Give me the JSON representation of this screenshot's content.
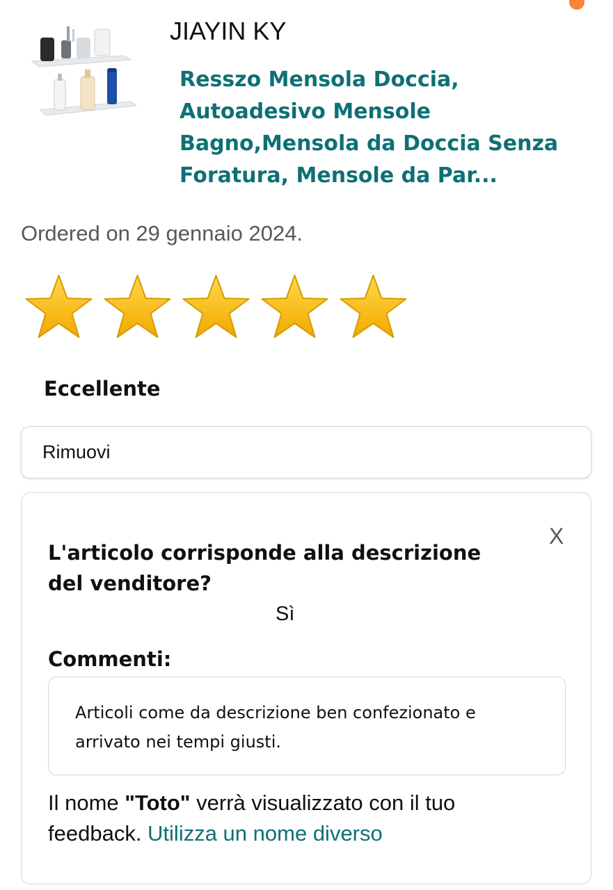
{
  "order": {
    "seller": "JIAYIN KY",
    "product_title": "Resszo Mensola Doccia, Autoadesivo Mensole Bagno,Mensola da Doccia Senza Foratura, Mensole da Par...",
    "ordered_text": "Ordered on 29 gennaio 2024."
  },
  "rating": {
    "stars": 5,
    "max_stars": 5,
    "label": "Eccellente",
    "star_color": "#f5b800"
  },
  "remove_button": {
    "label": "Rimuovi"
  },
  "feedback": {
    "close_label": "X",
    "question": "L'articolo corrisponde alla descrizione del venditore?",
    "answer": "Sì",
    "comments_label": "Commenti:",
    "comment_text": "Articoli come da descrizione ben confezionato e arrivato nei tempi giusti.",
    "name_prefix": "Il nome ",
    "display_name": "\"Toto\"",
    "name_suffix": " verrà visualizzato con il tuo feedback. ",
    "change_name_link": "Utilizza un nome diverso"
  },
  "colors": {
    "link": "#0e7075",
    "muted": "#565959",
    "border": "#d5d9d9"
  }
}
